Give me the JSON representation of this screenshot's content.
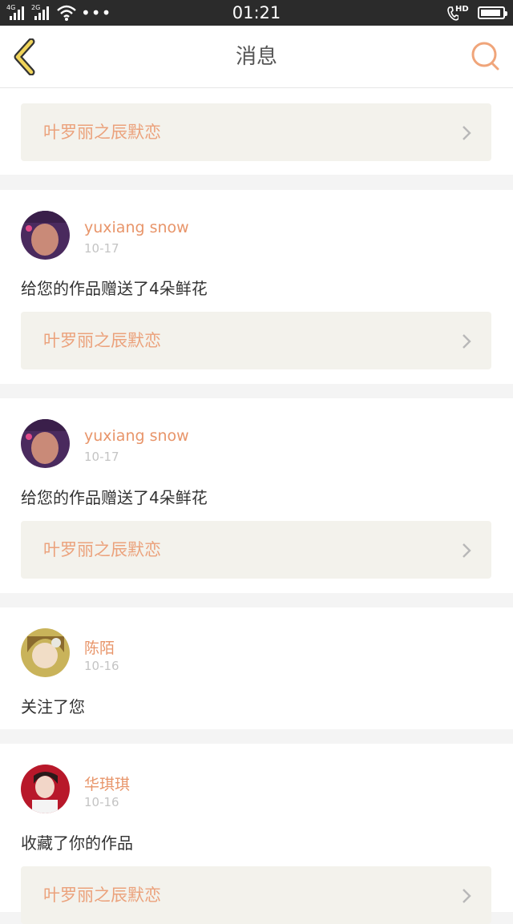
{
  "status_bar": {
    "network1": "4G",
    "network2": "2G",
    "time": "01:21",
    "call_badge": "HD",
    "battery_level": 0.92
  },
  "header": {
    "title": "消息",
    "back_icon": "chevron-left-icon",
    "search_icon": "search-icon"
  },
  "colors": {
    "accent": "#e8956a",
    "back_icon_fill": "#f0d45a",
    "link_bg": "#f3f2ec"
  },
  "notifications": [
    {
      "work_title": "叶罗丽之辰默恋"
    },
    {
      "username": "yuxiang snow",
      "date": "10-17",
      "message": "给您的作品赠送了4朵鲜花",
      "work_title": "叶罗丽之辰默恋"
    },
    {
      "username": "yuxiang snow",
      "date": "10-17",
      "message": "给您的作品赠送了4朵鲜花",
      "work_title": "叶罗丽之辰默恋"
    },
    {
      "username": "陈陌",
      "date": "10-16",
      "message": "关注了您"
    },
    {
      "username": "华琪琪",
      "date": "10-16",
      "message": "收藏了你的作品",
      "work_title": "叶罗丽之辰默恋"
    }
  ]
}
